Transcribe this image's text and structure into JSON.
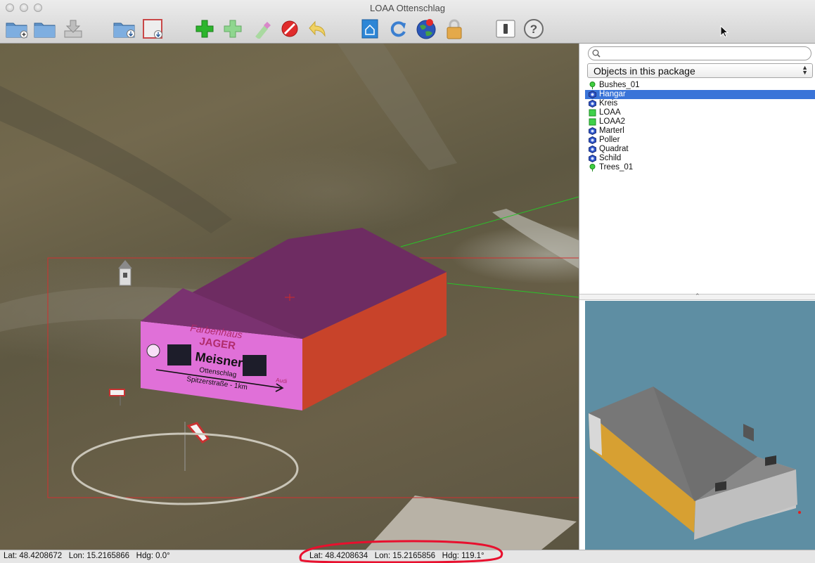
{
  "window": {
    "title": "LOAA Ottenschlag"
  },
  "toolbar": {
    "buttons": [
      {
        "icon": "new-folder-icon"
      },
      {
        "icon": "open-folder-icon"
      },
      {
        "icon": "save-tray-icon"
      },
      {
        "icon": "import-folder-icon"
      },
      {
        "icon": "export-box-icon"
      },
      {
        "icon": "add-green-plus-icon"
      },
      {
        "icon": "add-light-plus-icon"
      },
      {
        "icon": "marker-icon"
      },
      {
        "icon": "delete-icon"
      },
      {
        "icon": "undo-icon"
      },
      {
        "icon": "home-view-icon"
      },
      {
        "icon": "refresh-icon"
      },
      {
        "icon": "globe-icon"
      },
      {
        "icon": "lock-icon"
      },
      {
        "icon": "switch-icon"
      },
      {
        "icon": "help-icon"
      }
    ]
  },
  "sidebar": {
    "search": {
      "value": "",
      "placeholder": ""
    },
    "package_select": {
      "selected": "Objects in this package"
    },
    "objects": [
      {
        "label": "Bushes_01",
        "kind": "tree",
        "selected": false
      },
      {
        "label": "Hangar",
        "kind": "object",
        "selected": true
      },
      {
        "label": "Kreis",
        "kind": "object",
        "selected": false
      },
      {
        "label": "LOAA",
        "kind": "polygon",
        "selected": false
      },
      {
        "label": "LOAA2",
        "kind": "polygon",
        "selected": false
      },
      {
        "label": "Marterl",
        "kind": "object",
        "selected": false
      },
      {
        "label": "Poller",
        "kind": "object",
        "selected": false
      },
      {
        "label": "Quadrat",
        "kind": "object",
        "selected": false
      },
      {
        "label": "Schild",
        "kind": "object",
        "selected": false
      },
      {
        "label": "Trees_01",
        "kind": "tree",
        "selected": false
      }
    ]
  },
  "hangar_sign": {
    "line1": "Farbenhaus",
    "line2": "JAGER",
    "line3": "Meisner",
    "line4": "Ottenschlag",
    "line5": "Spitzerstraße - 1km",
    "brand": "Audi"
  },
  "statusbar": {
    "left": "Lat: 48.4208672   Lon: 15.2165866   Hdg: 0.0°",
    "right": "Lat: 48.4208634   Lon: 15.2165856   Hdg: 119.1°"
  },
  "colors": {
    "selection": "#3a74d8",
    "highlight_ring": "#e8102e",
    "selection_box": "#d03030",
    "roof": "#6e2c62",
    "wall_front": "#e070d8",
    "wall_side": "#c8432a"
  }
}
